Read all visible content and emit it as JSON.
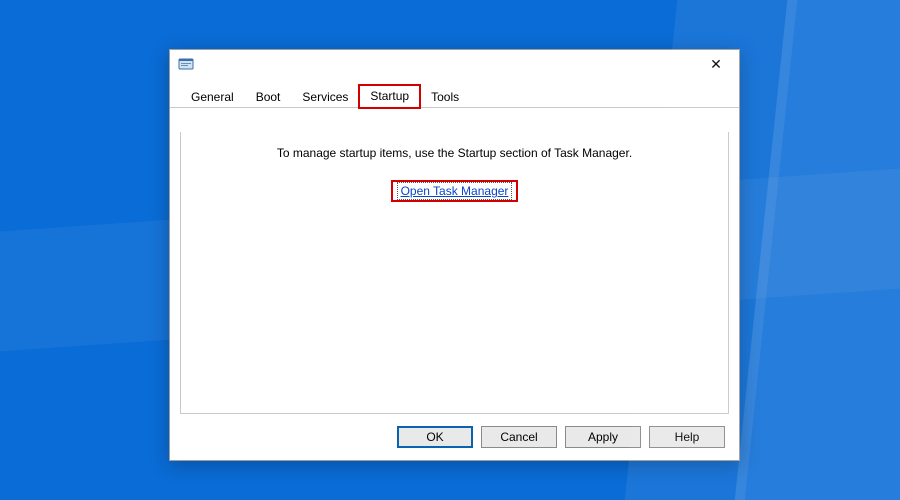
{
  "window": {
    "title": ""
  },
  "tabs": {
    "general": "General",
    "boot": "Boot",
    "services": "Services",
    "startup": "Startup",
    "tools": "Tools",
    "active": "startup"
  },
  "startup_page": {
    "message": "To manage startup items, use the Startup section of Task Manager.",
    "link_label": "Open Task Manager"
  },
  "buttons": {
    "ok": "OK",
    "cancel": "Cancel",
    "apply": "Apply",
    "help": "Help"
  },
  "icons": {
    "app": "msconfig-icon",
    "close": "✕"
  },
  "highlight_color": "#d40000"
}
